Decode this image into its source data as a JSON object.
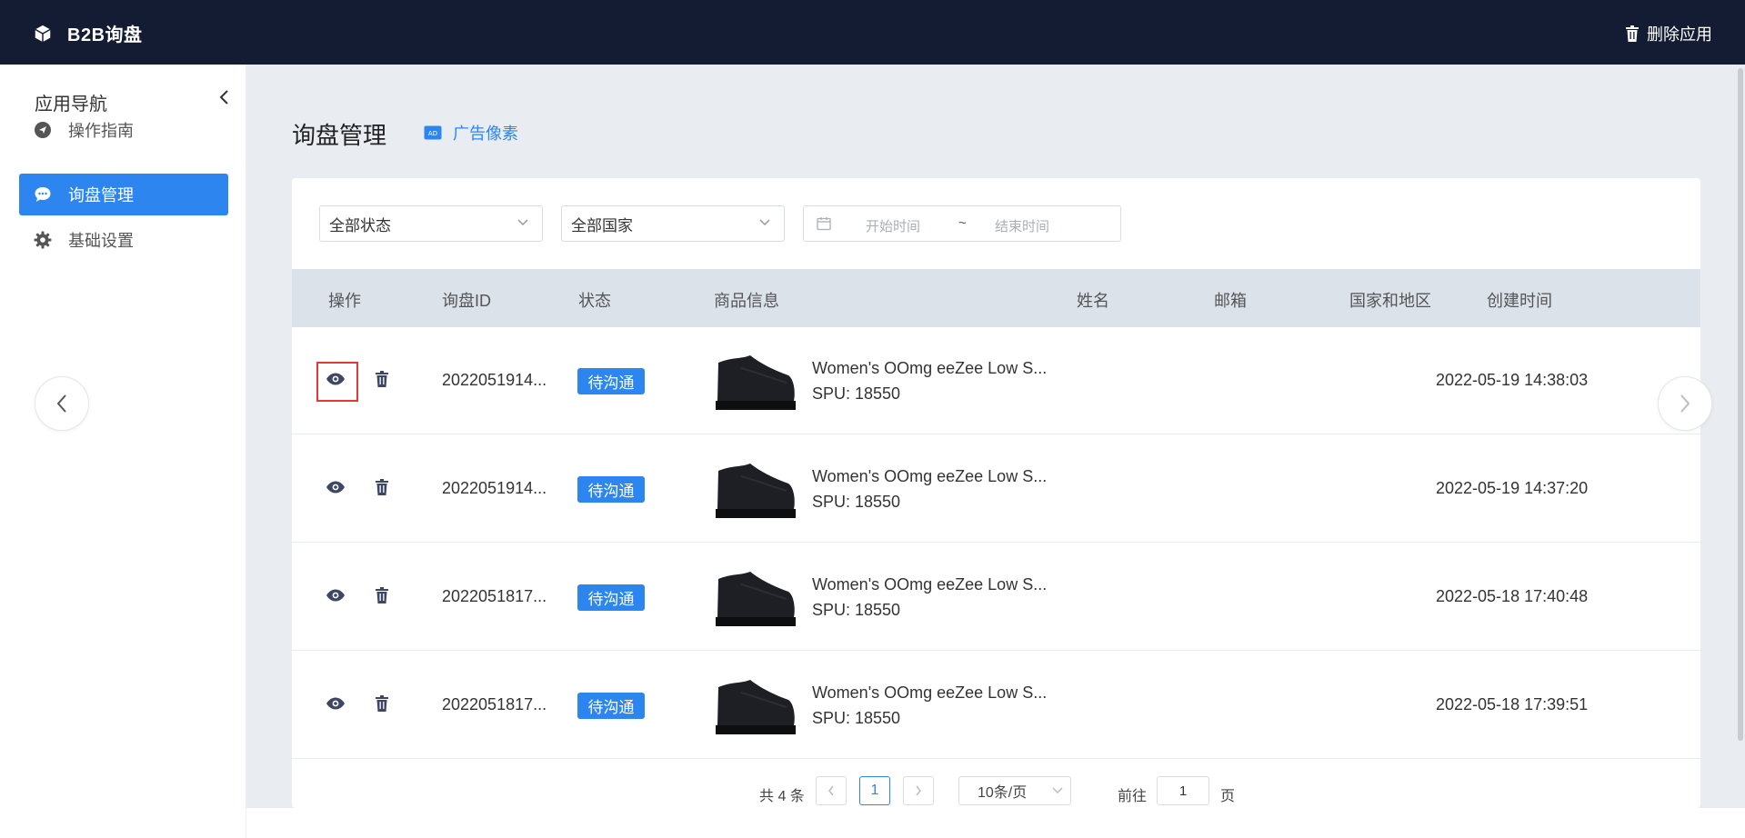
{
  "topbar": {
    "app_title": "B2B询盘",
    "delete_label": "删除应用",
    "brand_icon": "box-icon",
    "delete_icon": "trash-icon"
  },
  "sidebar": {
    "header": "应用导航",
    "items": [
      {
        "label": "操作指南",
        "icon": "navigation-icon",
        "active": false
      },
      {
        "label": "询盘管理",
        "icon": "chat-bubble-icon",
        "active": true
      },
      {
        "label": "基础设置",
        "icon": "gear-icon",
        "active": false
      }
    ]
  },
  "main": {
    "title": "询盘管理",
    "ad_link": "广告像素"
  },
  "filters": {
    "status": "全部状态",
    "country": "全部国家",
    "start_placeholder": "开始时间",
    "separator": "~",
    "end_placeholder": "结束时间"
  },
  "table": {
    "columns": [
      "操作",
      "询盘ID",
      "状态",
      "商品信息",
      "姓名",
      "邮箱",
      "国家和地区",
      "创建时间"
    ],
    "rows": [
      {
        "id": "2022051914...",
        "status": "待沟通",
        "product": "Women's OOmg eeZee Low S...",
        "spu": "SPU: 18550",
        "created": "2022-05-19 14:38:03"
      },
      {
        "id": "2022051914...",
        "status": "待沟通",
        "product": "Women's OOmg eeZee Low S...",
        "spu": "SPU: 18550",
        "created": "2022-05-19 14:37:20"
      },
      {
        "id": "2022051817...",
        "status": "待沟通",
        "product": "Women's OOmg eeZee Low S...",
        "spu": "SPU: 18550",
        "created": "2022-05-18 17:40:48"
      },
      {
        "id": "2022051817...",
        "status": "待沟通",
        "product": "Women's OOmg eeZee Low S...",
        "spu": "SPU: 18550",
        "created": "2022-05-18 17:39:51"
      }
    ]
  },
  "pagination": {
    "total": "共 4 条",
    "current_page": "1",
    "page_size": "10条/页",
    "goto_label": "前往",
    "goto_value": "1",
    "goto_suffix": "页"
  },
  "colors": {
    "topbar": "#141c33",
    "accent": "#2d86f0",
    "highlight": "#e53935",
    "background": "#e9ecf1"
  }
}
